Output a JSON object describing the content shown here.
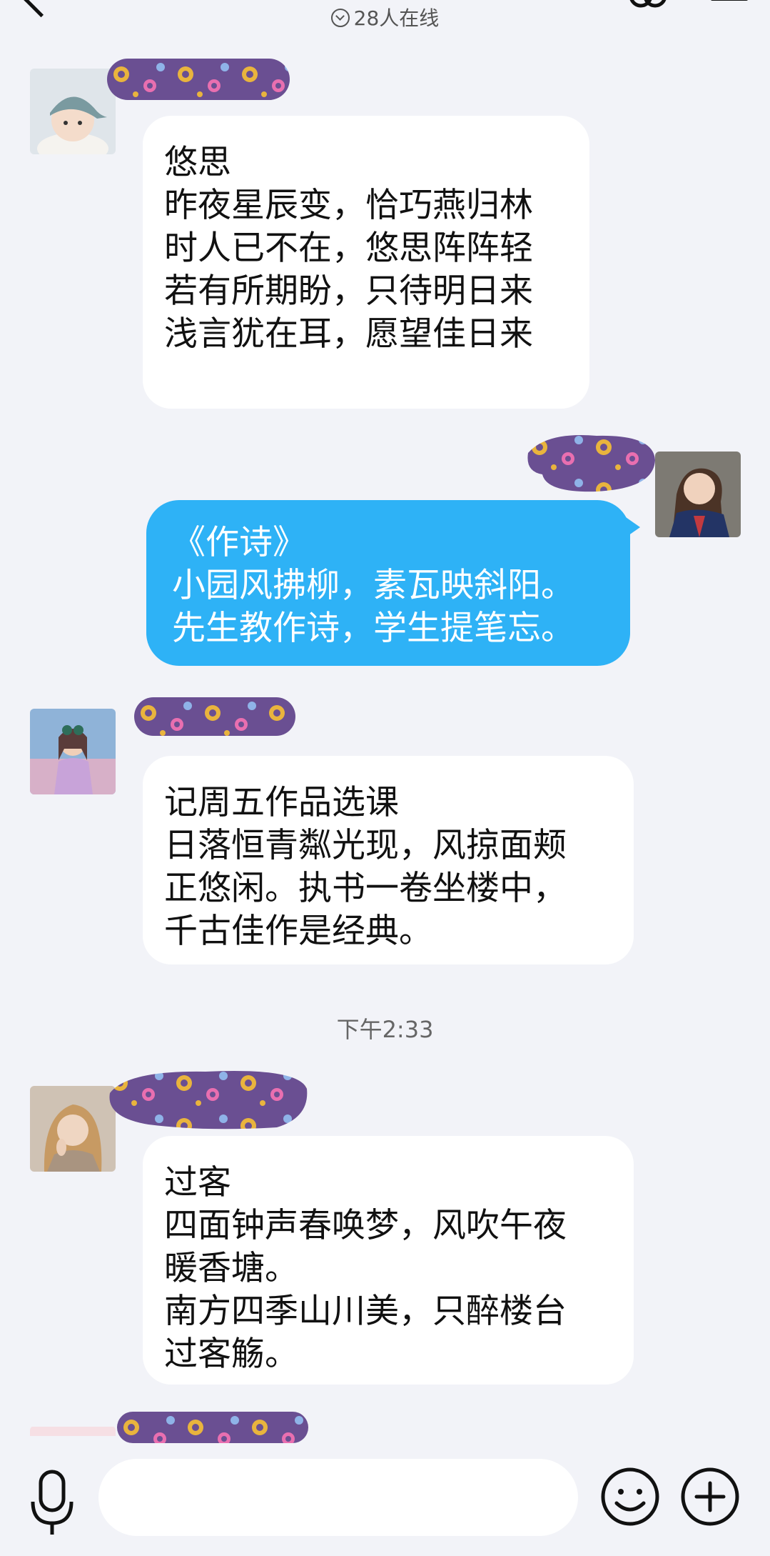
{
  "header": {
    "online_text": "28人在线"
  },
  "messages": [
    {
      "title": "悠思",
      "lines": [
        "昨夜星辰变，恰巧燕归林",
        "时人已不在，悠思阵阵轻",
        "若有所期盼，只待明日来",
        "浅言犹在耳，愿望佳日来"
      ]
    },
    {
      "title": "《作诗》",
      "lines": [
        "小园风拂柳，素瓦映斜阳。",
        "先生教作诗，学生提笔忘。"
      ]
    },
    {
      "title": "记周五作品选课",
      "lines": [
        "日落恒青粼光现，风掠面颊",
        "正悠闲。执书一卷坐楼中，",
        "千古佳作是经典。"
      ]
    },
    {
      "title": "过客",
      "lines": [
        "四面钟声春唤梦，风吹午夜",
        "暖香塘。",
        "南方四季山川美，只醉楼台",
        "过客觞。"
      ]
    }
  ],
  "timestamp": "下午2:33",
  "colors": {
    "background": "#f2f3f8",
    "outgoing_bubble": "#2eb2f6",
    "incoming_bubble": "#ffffff",
    "scribble": "#6a4f92"
  },
  "icons": [
    "back-icon",
    "chevron-down-icon",
    "link-icon",
    "menu-icon",
    "mic-icon",
    "emoji-icon",
    "plus-icon"
  ]
}
